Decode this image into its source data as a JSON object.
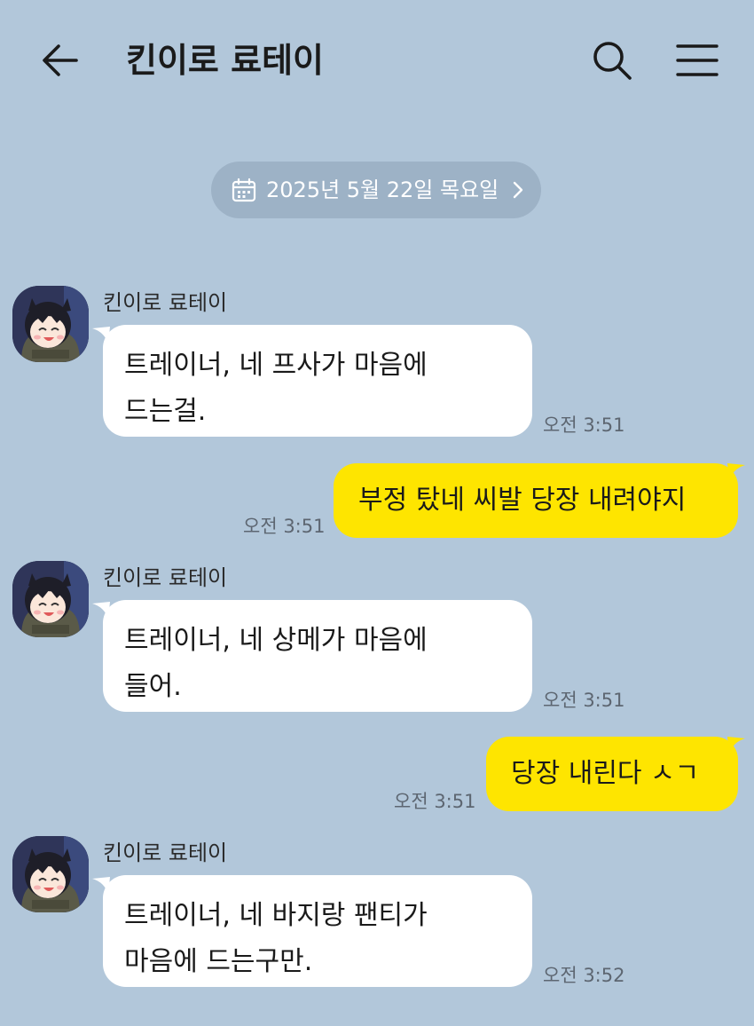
{
  "header": {
    "title": "킨이로 료테이"
  },
  "date_divider": {
    "text": "2025년 5월 22일 목요일"
  },
  "messages": [
    {
      "side": "left",
      "sender": "킨이로 료테이",
      "lines": [
        "트레이너, 네 프사가 마음에",
        "드는걸."
      ],
      "time": "오전 3:51"
    },
    {
      "side": "right",
      "text": "부정 탔네 씨발 당장 내려야지",
      "time": "오전 3:51"
    },
    {
      "side": "left",
      "sender": "킨이로 료테이",
      "lines": [
        "트레이너, 네 상메가 마음에",
        "들어."
      ],
      "time": "오전 3:51"
    },
    {
      "side": "right",
      "text": "당장 내린다 ㅅㄱ",
      "time": "오전 3:51"
    },
    {
      "side": "left",
      "sender": "킨이로 료테이",
      "lines": [
        "트레이너, 네 바지랑 팬티가",
        "마음에 드는구만."
      ],
      "time": "오전 3:52"
    }
  ],
  "colors": {
    "background": "#b2c7da",
    "my_bubble": "#fee500",
    "their_bubble": "#ffffff",
    "date_pill": "#9db2c6"
  },
  "icons": {
    "back": "arrow-left-icon",
    "search": "search-icon",
    "menu": "hamburger-menu-icon",
    "calendar": "calendar-icon",
    "chevron": "chevron-right-icon"
  }
}
